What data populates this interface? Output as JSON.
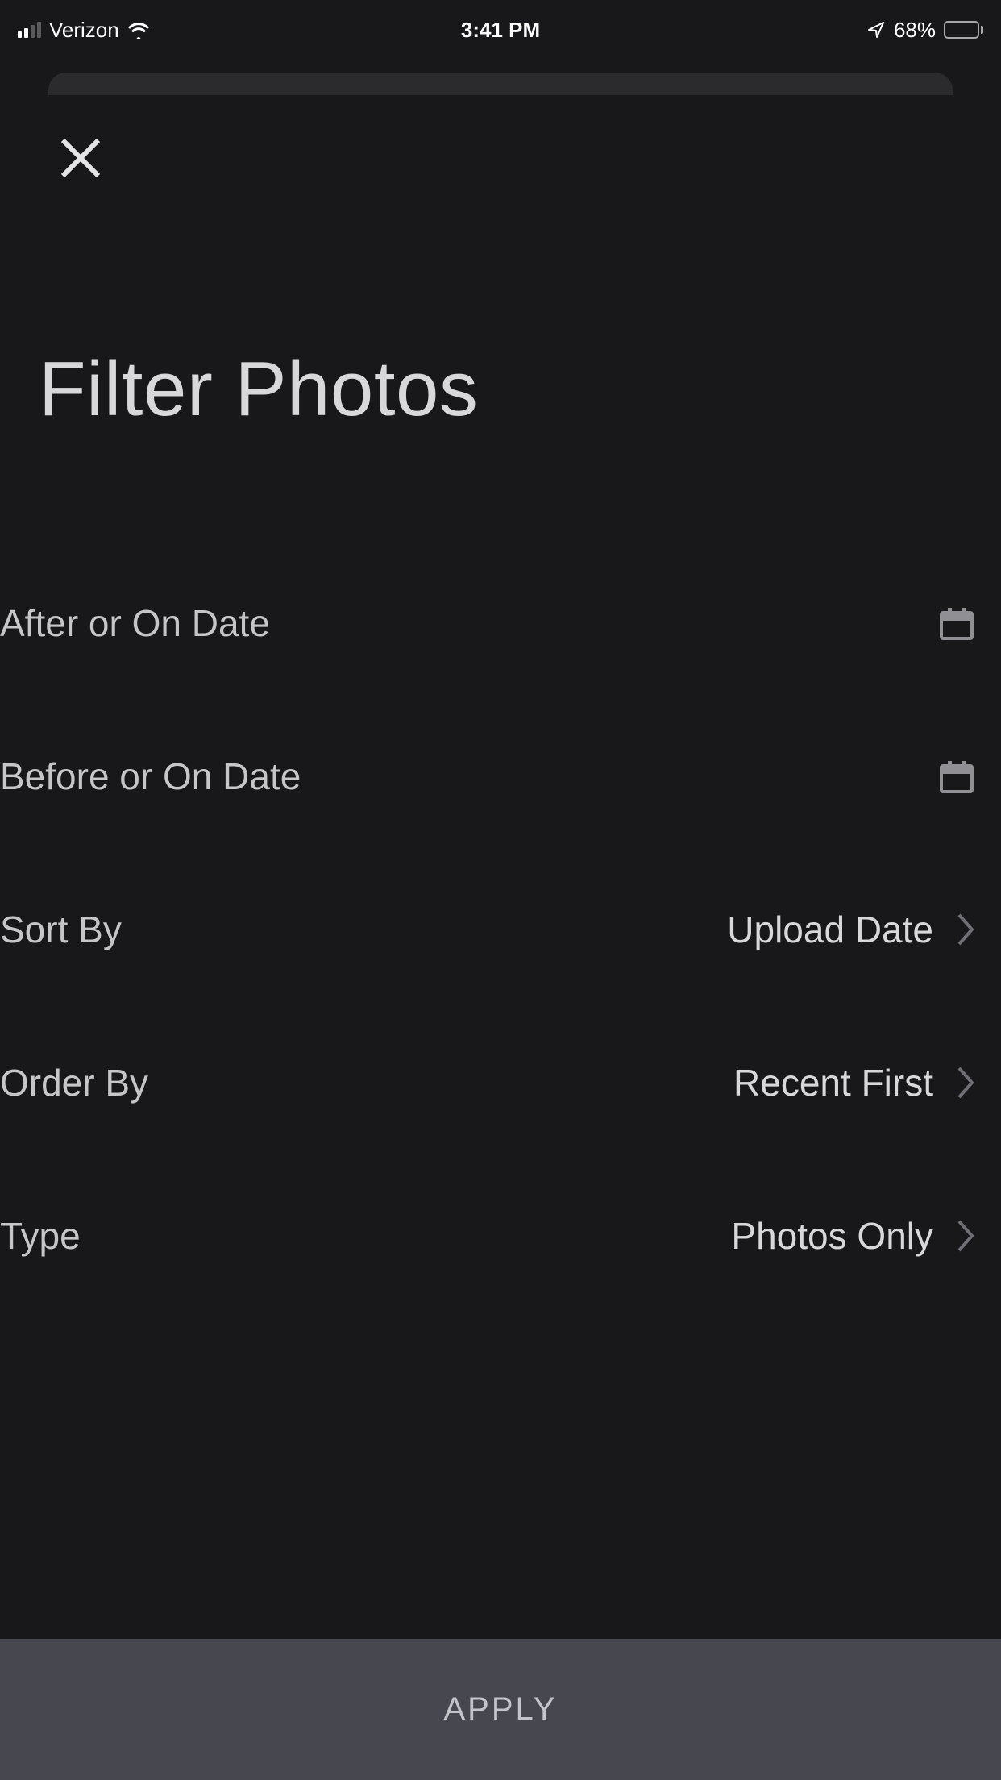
{
  "status_bar": {
    "carrier": "Verizon",
    "time": "3:41 PM",
    "battery_pct": "68%"
  },
  "sheet": {
    "title": "Filter Photos"
  },
  "filters": {
    "after_date": {
      "label": "After or On Date",
      "value": ""
    },
    "before_date": {
      "label": "Before or On Date",
      "value": ""
    },
    "sort_by": {
      "label": "Sort By",
      "value": "Upload Date"
    },
    "order_by": {
      "label": "Order By",
      "value": "Recent First"
    },
    "type": {
      "label": "Type",
      "value": "Photos Only"
    }
  },
  "actions": {
    "apply": "APPLY"
  }
}
